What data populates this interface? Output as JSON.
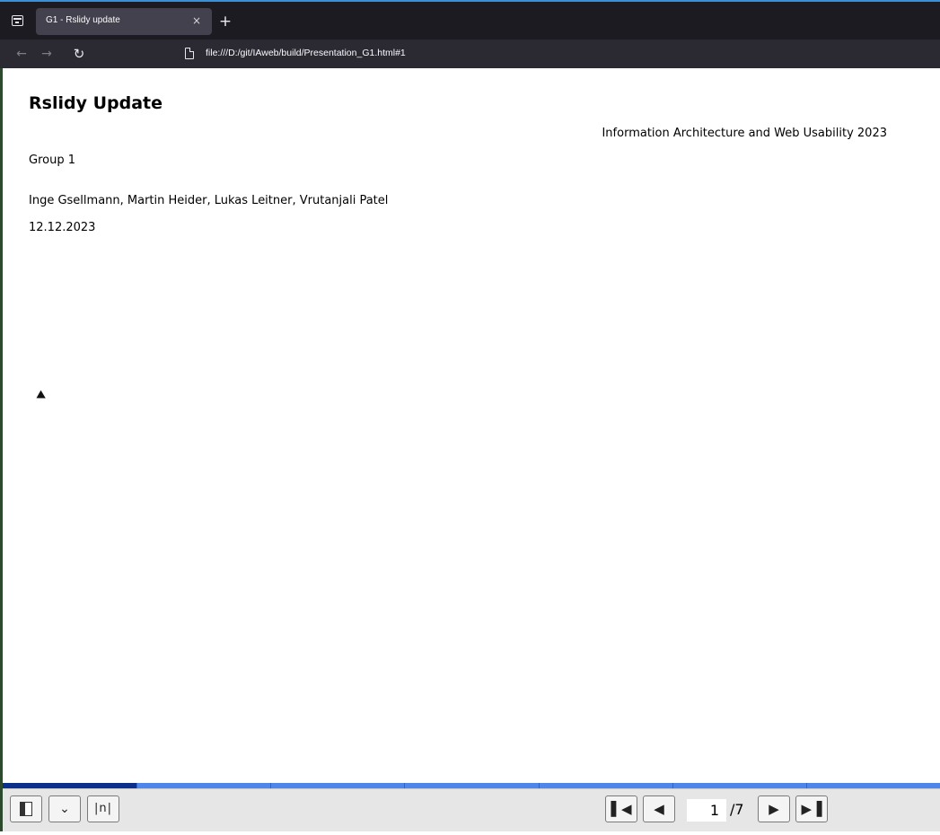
{
  "browser": {
    "tab": {
      "title": "G1 - Rslidy update",
      "close_glyph": "×"
    },
    "new_tab_glyph": "+",
    "nav": {
      "back_glyph": "←",
      "forward_glyph": "→",
      "reload_glyph": "C"
    },
    "url": "file:///D:/git/IAweb/build/Presentation_G1.html#1"
  },
  "slide": {
    "title": "Rslidy Update",
    "course": "Information Architecture and Web Usability 2023",
    "group": "Group 1",
    "authors": "Inge Gsellmann, Martin Heider, Lukas Leitner, Vrutanjali Patel",
    "date": "12.12.2023"
  },
  "progress": {
    "current_slide": 1,
    "total_slides": 7
  },
  "toolbar": {
    "toc_icon": "table-of-contents-icon",
    "expand_glyph": "≚",
    "number_label": "|n|",
    "first_glyph": "⏮",
    "prev_glyph": "◀",
    "next_glyph": "▶",
    "last_glyph": "⏭",
    "page_value": "1",
    "page_total": "/7"
  },
  "colors": {
    "titlebar": "#1c1b22",
    "tab_active": "#42414d",
    "navbar": "#2b2a33",
    "progress_done": "#0b2f8a",
    "progress_remaining": "#4f86ec",
    "toolbar": "#e6e6e6"
  }
}
